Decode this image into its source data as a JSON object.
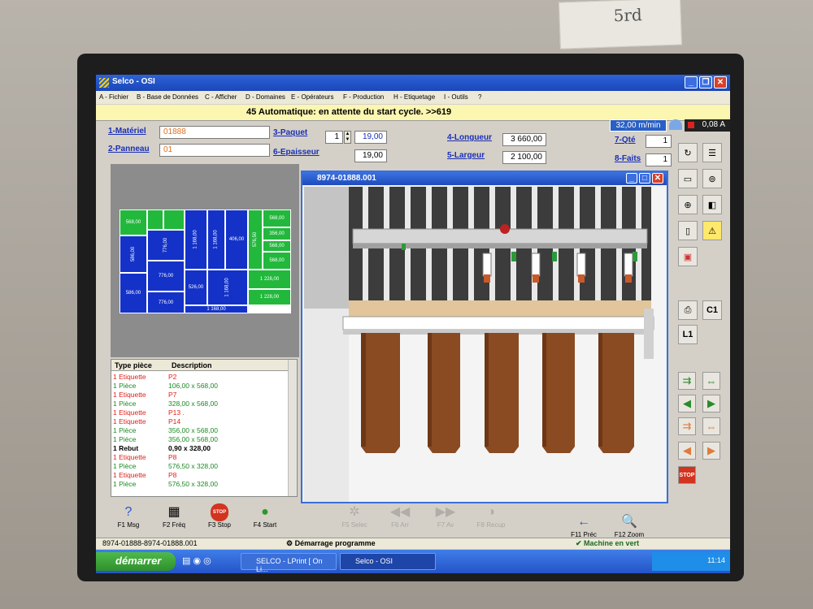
{
  "window": {
    "title": "Selco - OSI",
    "menu": [
      "A - Fichier",
      "B - Base de Données",
      "C - Afficher",
      "D - Domaines",
      "E - Opérateurs",
      "F - Production",
      "H - Etiquetage",
      "I - Outils",
      "?"
    ]
  },
  "status": {
    "message": "45 Automatique: en attente du start cycle. >>619",
    "speed": "32,00 m/min",
    "current": "0,08 A"
  },
  "params": {
    "materiel_label": "1-Matériel",
    "materiel_value": "01888",
    "panneau_label": "2-Panneau",
    "panneau_value": "01",
    "paquet_label": "3-Paquet",
    "paquet_count": "1",
    "paquet_value": "19,00",
    "epaisseur_label": "6-Epaisseur",
    "epaisseur_value": "19,00",
    "longueur_label": "4-Longueur",
    "longueur_value": "3 660,00",
    "largeur_label": "5-Largeur",
    "largeur_value": "2 100,00",
    "qte_label": "7-Qté",
    "qte_value": "1",
    "faits_label": "8-Faits",
    "faits_value": "1"
  },
  "nesting": {
    "pieces": [
      "568,00",
      "568,00",
      "776,00",
      "586,00",
      "776,00",
      "776,00",
      "586,00",
      "1 168,00",
      "1 168,00",
      "406,00",
      "526,00",
      "1 168,00",
      "576,50",
      "568,00",
      "356,00",
      "568,00",
      "568,00",
      "356,00",
      "1 228,00",
      "1 228,00",
      "586,00",
      "406,00",
      "776,00"
    ]
  },
  "piece_list": {
    "col_type": "Type pièce",
    "col_desc": "Description",
    "rows": [
      {
        "type": "1 Etiquette",
        "desc": "P2"
      },
      {
        "type": "1 Pièce",
        "desc": "106,00 x 568,00"
      },
      {
        "type": "1 Etiquette",
        "desc": "P7"
      },
      {
        "type": "1 Pièce",
        "desc": "328,00 x 568,00"
      },
      {
        "type": "1 Etiquette",
        "desc": "P13 ."
      },
      {
        "type": "1 Etiquette",
        "desc": "P14"
      },
      {
        "type": "1 Pièce",
        "desc": "356,00 x 568,00"
      },
      {
        "type": "1 Pièce",
        "desc": "356,00 x 568,00"
      },
      {
        "type": "1 Rebut",
        "desc": "0,90 x 328,00"
      },
      {
        "type": "1 Etiquette",
        "desc": "P8"
      },
      {
        "type": "1 Pièce",
        "desc": "576,50 x 328,00"
      },
      {
        "type": "1 Etiquette",
        "desc": "P8"
      },
      {
        "type": "1 Pièce",
        "desc": "576,50 x 328,00"
      }
    ]
  },
  "view": {
    "title": "8974-01888.001"
  },
  "toolbar_right": {
    "c1_label": "C1",
    "l1_label": "L1"
  },
  "fkeys": [
    {
      "label": "F1 Msg",
      "icon": "?"
    },
    {
      "label": "F2 Fréq",
      "icon": "▦"
    },
    {
      "label": "F3 Stop",
      "icon": "STOP"
    },
    {
      "label": "F4 Start",
      "icon": "●"
    },
    {
      "label": "F5 Selec",
      "icon": "✲"
    },
    {
      "label": "F6 Arr",
      "icon": "◀◀"
    },
    {
      "label": "F7 Av",
      "icon": "▶▶"
    },
    {
      "label": "F8 Recup",
      "icon": "◑"
    },
    {
      "label": "F11 Préc",
      "icon": "←"
    },
    {
      "label": "F12 Zoom",
      "icon": "🔍"
    }
  ],
  "bottom_status": {
    "file": "8974-01888-8974-01888.001",
    "program": "Démarrage programme",
    "machine": "Machine en vert"
  },
  "taskbar": {
    "start": "démarrer",
    "tasks": [
      "SELCO - LPrint [ On Li...",
      "Selco - OSI"
    ],
    "clock": "11:14"
  },
  "note_text": "5rd"
}
